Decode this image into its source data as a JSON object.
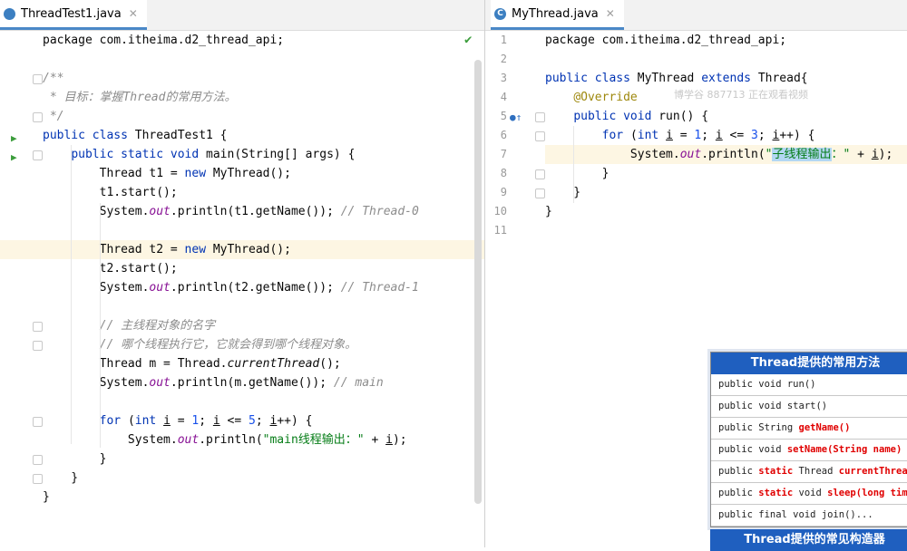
{
  "left_tab": {
    "label": "ThreadTest1.java",
    "close": "✕"
  },
  "right_tab": {
    "label": "MyThread.java",
    "icon": "C",
    "close": "✕"
  },
  "left_code": [
    [
      [
        "t",
        "package com.itheima.d2_thread_api;"
      ]
    ],
    [],
    [
      [
        "c",
        "/**"
      ]
    ],
    [
      [
        "c",
        " * 目标：掌握Thread的常用方法。"
      ]
    ],
    [
      [
        "c",
        " */"
      ]
    ],
    [
      [
        "k",
        "public class "
      ],
      [
        "t",
        "ThreadTest1 {"
      ]
    ],
    [
      [
        "t",
        "    "
      ],
      [
        "k",
        "public static void "
      ],
      [
        "t",
        "main(String[] args) {"
      ]
    ],
    [
      [
        "t",
        "        Thread t1 = "
      ],
      [
        "k",
        "new "
      ],
      [
        "t",
        "MyThread();"
      ]
    ],
    [
      [
        "t",
        "        t1.start();"
      ]
    ],
    [
      [
        "t",
        "        System."
      ],
      [
        "f",
        "out"
      ],
      [
        "t",
        ".println(t1.getName()); "
      ],
      [
        "c",
        "// Thread-0"
      ]
    ],
    [],
    [
      [
        "t",
        "        Thread t2 = "
      ],
      [
        "k",
        "new "
      ],
      [
        "t",
        "MyThread();"
      ]
    ],
    [
      [
        "t",
        "        t2.start();"
      ]
    ],
    [
      [
        "t",
        "        System."
      ],
      [
        "f",
        "out"
      ],
      [
        "t",
        ".println(t2.getName()); "
      ],
      [
        "c",
        "// Thread-1"
      ]
    ],
    [],
    [
      [
        "t",
        "        "
      ],
      [
        "c",
        "// 主线程对象的名字"
      ]
    ],
    [
      [
        "t",
        "        "
      ],
      [
        "c",
        "// 哪个线程执行它，它就会得到哪个线程对象。"
      ]
    ],
    [
      [
        "t",
        "        Thread m = Thread."
      ],
      [
        "i",
        "currentThread"
      ],
      [
        "t",
        "();"
      ]
    ],
    [
      [
        "t",
        "        System."
      ],
      [
        "f",
        "out"
      ],
      [
        "t",
        ".println(m.getName()); "
      ],
      [
        "c",
        "// main"
      ]
    ],
    [],
    [
      [
        "t",
        "        "
      ],
      [
        "k",
        "for "
      ],
      [
        "t",
        "("
      ],
      [
        "k",
        "int "
      ],
      [
        "u",
        "i"
      ],
      [
        "t",
        " = "
      ],
      [
        "n",
        "1"
      ],
      [
        "t",
        "; "
      ],
      [
        "u",
        "i"
      ],
      [
        "t",
        " <= "
      ],
      [
        "n",
        "5"
      ],
      [
        "t",
        "; "
      ],
      [
        "u",
        "i"
      ],
      [
        "t",
        "++) {"
      ]
    ],
    [
      [
        "t",
        "            System."
      ],
      [
        "f",
        "out"
      ],
      [
        "t",
        ".println("
      ],
      [
        "s",
        "\"main线程输出：\""
      ],
      [
        "t",
        " + "
      ],
      [
        "u",
        "i"
      ],
      [
        "t",
        ");"
      ]
    ],
    [
      [
        "t",
        "        }"
      ]
    ],
    [
      [
        "t",
        "    }"
      ]
    ],
    [
      [
        "t",
        "}"
      ]
    ]
  ],
  "right_code": [
    [
      [
        "t",
        "package com.itheima.d2_thread_api;"
      ]
    ],
    [],
    [
      [
        "k",
        "public class "
      ],
      [
        "t",
        "MyThread "
      ],
      [
        "k",
        "extends "
      ],
      [
        "t",
        "Thread{"
      ]
    ],
    [
      [
        "t",
        "    "
      ],
      [
        "a",
        "@Override"
      ]
    ],
    [
      [
        "t",
        "    "
      ],
      [
        "k",
        "public void "
      ],
      [
        "t",
        "run() {"
      ]
    ],
    [
      [
        "t",
        "        "
      ],
      [
        "k",
        "for "
      ],
      [
        "t",
        "("
      ],
      [
        "k",
        "int "
      ],
      [
        "u",
        "i"
      ],
      [
        "t",
        " = "
      ],
      [
        "n",
        "1"
      ],
      [
        "t",
        "; "
      ],
      [
        "u",
        "i"
      ],
      [
        "t",
        " <= "
      ],
      [
        "n",
        "3"
      ],
      [
        "t",
        "; "
      ],
      [
        "u",
        "i"
      ],
      [
        "t",
        "++) {"
      ]
    ],
    [
      [
        "t",
        "            System."
      ],
      [
        "f",
        "out"
      ],
      [
        "t",
        ".println("
      ],
      [
        "s",
        "\""
      ],
      [
        "h",
        "子线程输出"
      ],
      [
        "s",
        "：\""
      ],
      [
        "t",
        " + "
      ],
      [
        "u",
        "i"
      ],
      [
        "t",
        ");"
      ]
    ],
    [
      [
        "t",
        "        }"
      ]
    ],
    [
      [
        "t",
        "    }"
      ]
    ],
    [
      [
        "t",
        "}"
      ]
    ],
    []
  ],
  "right_line_numbers": [
    "1",
    "2",
    "3",
    "4",
    "5",
    "6",
    "7",
    "8",
    "9",
    "10",
    "11"
  ],
  "watermark": "博学谷 887713 正在观看视频",
  "popup": {
    "title": "Thread提供的常用方法",
    "rows": [
      [
        [
          "t",
          "public void run()"
        ]
      ],
      [
        [
          "t",
          "public void start()"
        ]
      ],
      [
        [
          "t",
          "public String "
        ],
        [
          "r",
          "getName()"
        ]
      ],
      [
        [
          "t",
          "public void "
        ],
        [
          "r",
          "setName(String name)"
        ]
      ],
      [
        [
          "t",
          "public "
        ],
        [
          "r",
          "static"
        ],
        [
          "t",
          " Thread "
        ],
        [
          "r",
          "currentThread()"
        ]
      ],
      [
        [
          "t",
          "public "
        ],
        [
          "r",
          "static"
        ],
        [
          "t",
          " void "
        ],
        [
          "r",
          "sleep(long time)"
        ]
      ],
      [
        [
          "t",
          "public final void join()..."
        ]
      ]
    ]
  },
  "popup2_title": "Thread提供的常见构造器",
  "colors": {
    "tab_underline": "#4a88c7",
    "popup_header": "#1f5fbf",
    "highlight_line": "#fdf6e3",
    "run_arrow": "#3c9d3c",
    "check": "#3c9d3c"
  }
}
